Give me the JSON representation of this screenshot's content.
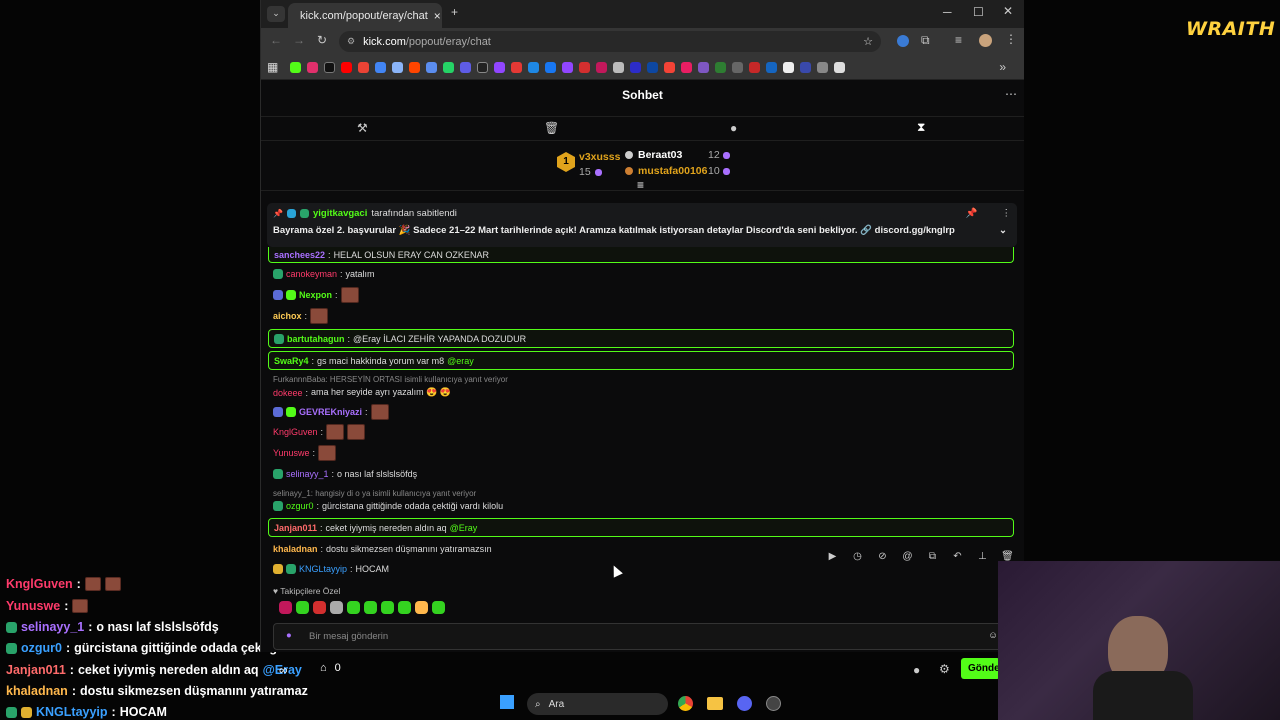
{
  "browser": {
    "tab_title": "kick.com/popout/eray/chat",
    "url_host": "kick.com",
    "url_path": "/popout/eray/chat"
  },
  "watermark": "WRAITH",
  "chat": {
    "title": "Sohbet",
    "leaderboard": {
      "first": {
        "rank": "1",
        "name": "v3xusss",
        "count": "15"
      },
      "second": {
        "name": "Beraat03",
        "count": "12"
      },
      "third": {
        "name": "mustafa00106",
        "count": "10"
      }
    },
    "pinned": {
      "user": "yigitkavgaci",
      "by_text": "tarafından sabitlendi",
      "message": "Bayrama özel 2. başvurular 🎉 Sadece 21–22 Mart tarihlerinde açık! Aramıza katılmak istiyorsan detaylar Discord'da seni bekliyor. 🔗 discord.gg/knglrp"
    },
    "messages": [
      {
        "user": "sanchees22",
        "text": "HELAL OLSUN ERAY CAN OZKENAR",
        "color": "#a970ff"
      },
      {
        "user": "canokeyman",
        "text": "yatalım",
        "color": "#ff3b6b"
      },
      {
        "user": "Nexpon",
        "text": "",
        "color": "#53fc18"
      },
      {
        "user": "aichox",
        "text": "",
        "color": "#ffcc55"
      },
      {
        "user": "bartutahagun",
        "text": "@Eray İLACI ZEHİR YAPANDA DOZUDUR",
        "color": "#53fc18"
      },
      {
        "user": "SwaRy4",
        "text": "gs maci hakkinda yorum var m8 @eray",
        "color": "#53fc18"
      },
      {
        "user": "dokeee",
        "text": "ama her seyide ayrı yazalım 😍 😍",
        "color": "#ff3b6b"
      },
      {
        "user": "GEVREKniyazi",
        "text": "",
        "color": "#a970ff"
      },
      {
        "user": "KnglGuven",
        "text": "",
        "color": "#ff3b6b"
      },
      {
        "user": "Yunuswe",
        "text": "",
        "color": "#ff3b6b"
      },
      {
        "user": "selinayy_1",
        "text": "o nası laf slslslsöfdş",
        "color": "#a970ff"
      },
      {
        "user": "ozgur0",
        "text": "gürcistana gittiğinde odada çektiği vardı kilolu",
        "color": "#53fc18"
      },
      {
        "user": "Janjan011",
        "text": "ceket iyiymiş nereden aldın aq @Eray",
        "color": "#ff6b6b"
      },
      {
        "user": "khaladnan",
        "text": "dostu sikmezsen düşmanını yatıramazsın",
        "color": "#ffb84d"
      },
      {
        "user": "KNGLtayyip",
        "text": "HOCAM",
        "color": "#3aa0ff"
      }
    ],
    "mentions": {
      "eray_highlight": "@Eray",
      "eray_lower": "@eray"
    },
    "replies": [
      "FurkannnBaba: HERSEYİN ORTASI isimli kullanıcıya yanıt veriyor",
      "selinayy_1: hangisiy di o ya isimli kullanıcıya yanıt veriyor"
    ],
    "follower_label": "Takipçilere Özel",
    "input_placeholder": "Bir mesaj gönderin",
    "send_label": "Gönder",
    "viewer_count": "0"
  },
  "overlay": [
    {
      "user": "KnglGuven",
      "text": ""
    },
    {
      "user": "Yunuswe",
      "text": ""
    },
    {
      "user": "selinayy_1",
      "text": "o nası laf slslslsöfdş"
    },
    {
      "user": "ozgur0",
      "text": "gürcistana gittiğinde odada çektiği vard"
    },
    {
      "user": "Janjan011",
      "text": "ceket iyiymiş nereden aldın aq"
    },
    {
      "user": "khaladnan",
      "text": "dostu sikmezsen düşmanını yatıramaz"
    },
    {
      "user": "KNGLtayyip",
      "text": "HOCAM"
    }
  ],
  "overlay_mention": "@Eray",
  "taskbar": {
    "search": "Ara"
  },
  "colors": {
    "kick_green": "#53fc18",
    "background": "#0b0b0c"
  }
}
